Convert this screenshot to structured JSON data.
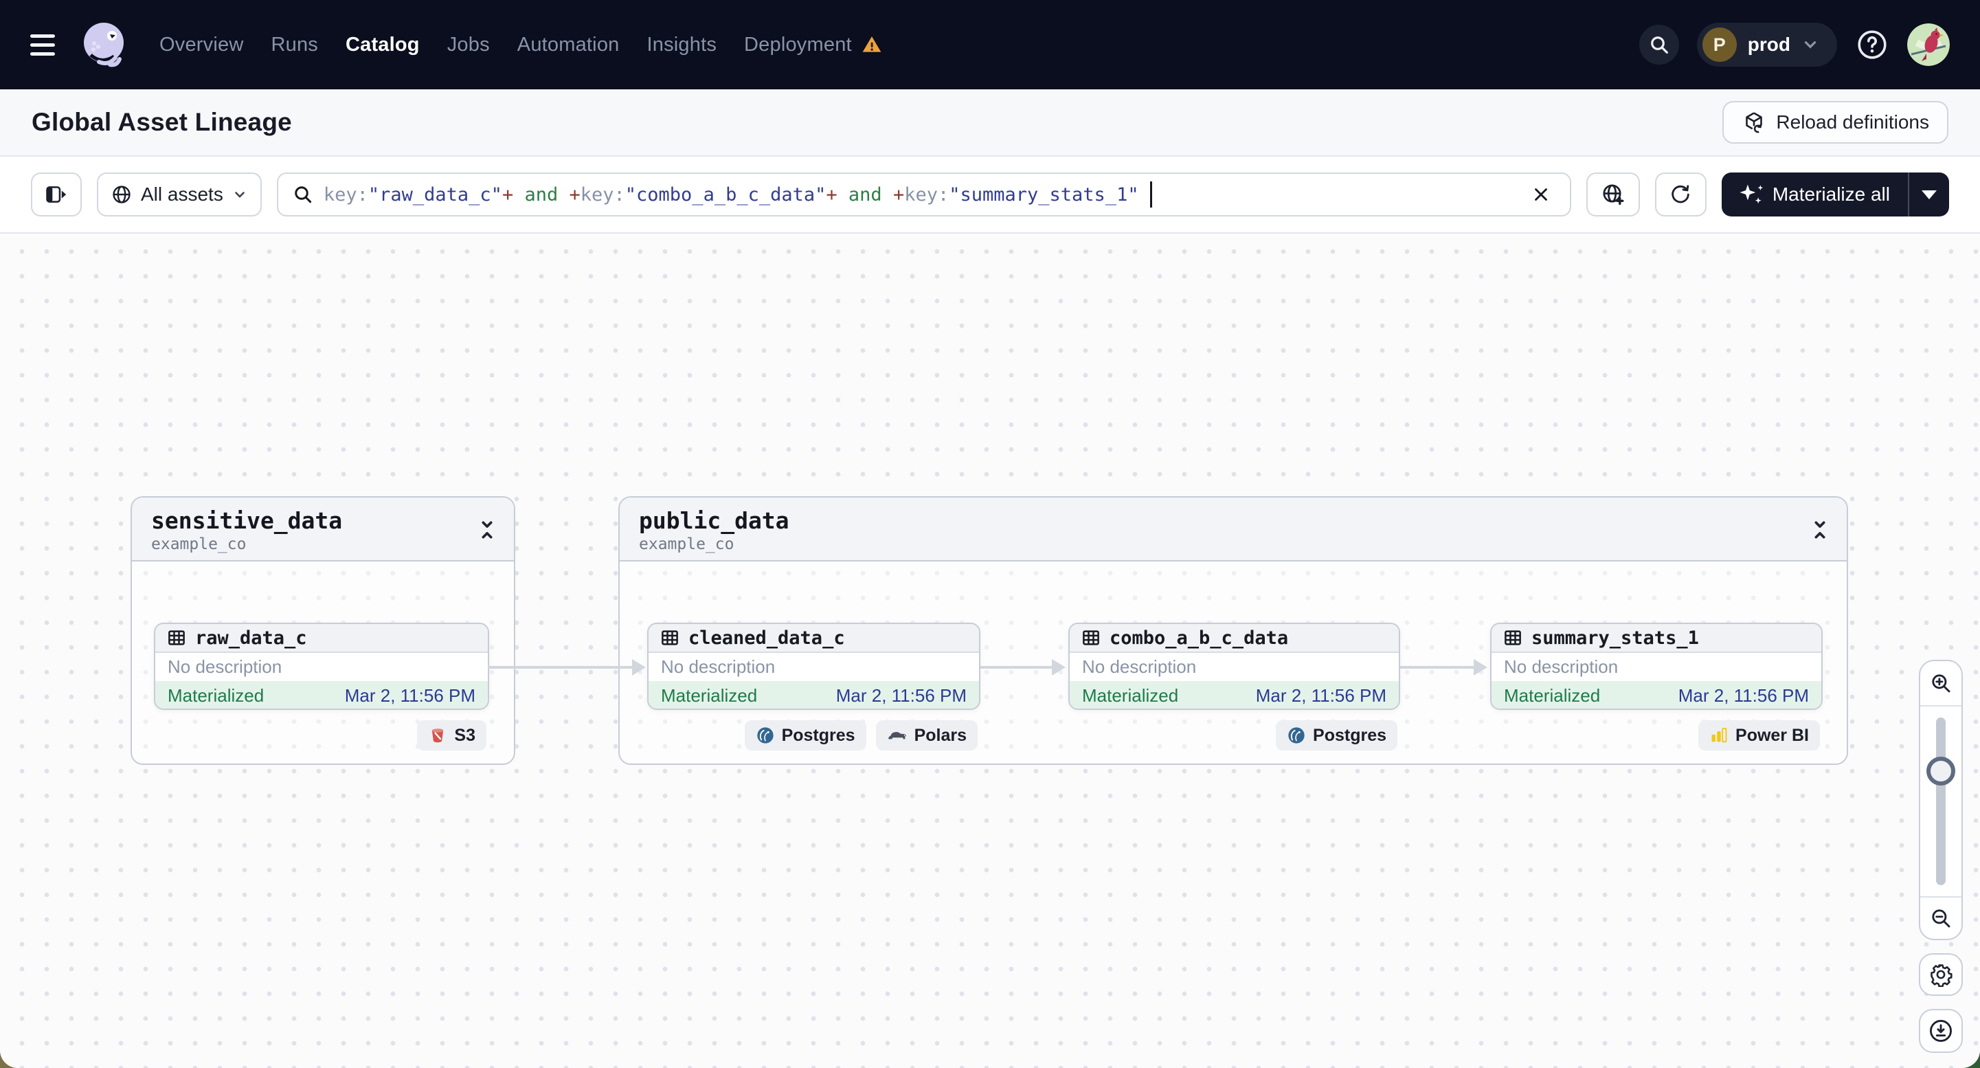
{
  "nav": {
    "items": [
      {
        "label": "Overview",
        "active": false
      },
      {
        "label": "Runs",
        "active": false
      },
      {
        "label": "Catalog",
        "active": true
      },
      {
        "label": "Jobs",
        "active": false
      },
      {
        "label": "Automation",
        "active": false
      },
      {
        "label": "Insights",
        "active": false
      },
      {
        "label": "Deployment",
        "active": false,
        "warning": true
      }
    ],
    "environment": {
      "initial": "P",
      "label": "prod"
    }
  },
  "header": {
    "title": "Global Asset Lineage",
    "reload_button_label": "Reload definitions"
  },
  "toolbar": {
    "asset_filter_label": "All assets",
    "materialize_button_label": "Materialize all",
    "query_segments": [
      {
        "text": "key:",
        "color": "gray"
      },
      {
        "text": "\"raw_data_c\"",
        "color": "navy"
      },
      {
        "text": "+",
        "color": "red"
      },
      {
        "text": " and ",
        "color": "green"
      },
      {
        "text": "+",
        "color": "red"
      },
      {
        "text": "key:",
        "color": "gray"
      },
      {
        "text": "\"combo_a_b_c_data\"",
        "color": "navy"
      },
      {
        "text": "+",
        "color": "red"
      },
      {
        "text": " and ",
        "color": "green"
      },
      {
        "text": "+",
        "color": "red"
      },
      {
        "text": "key:",
        "color": "gray"
      },
      {
        "text": "\"summary_stats_1\"",
        "color": "navy"
      }
    ]
  },
  "graph": {
    "groups": [
      {
        "name": "sensitive_data",
        "location": "example_co",
        "assets": [
          {
            "name": "raw_data_c",
            "description": "No description",
            "status": "Materialized",
            "timestamp": "Mar 2, 11:56 PM",
            "tags": [
              {
                "label": "S3",
                "icon": "s3-icon"
              }
            ]
          }
        ]
      },
      {
        "name": "public_data",
        "location": "example_co",
        "assets": [
          {
            "name": "cleaned_data_c",
            "description": "No description",
            "status": "Materialized",
            "timestamp": "Mar 2, 11:56 PM",
            "tags": [
              {
                "label": "Postgres",
                "icon": "postgres-icon"
              },
              {
                "label": "Polars",
                "icon": "polars-icon"
              }
            ]
          },
          {
            "name": "combo_a_b_c_data",
            "description": "No description",
            "status": "Materialized",
            "timestamp": "Mar 2, 11:56 PM",
            "tags": [
              {
                "label": "Postgres",
                "icon": "postgres-icon"
              }
            ]
          },
          {
            "name": "summary_stats_1",
            "description": "No description",
            "status": "Materialized",
            "timestamp": "Mar 2, 11:56 PM",
            "tags": [
              {
                "label": "Power BI",
                "icon": "powerbi-icon"
              }
            ]
          }
        ]
      }
    ]
  },
  "controls": {
    "zoom_slider_fraction": 0.28
  },
  "colors": {
    "nav_bg": "#0a0e1e",
    "status_green_text": "#1e7b49",
    "status_green_bg": "#e4f3ea",
    "timestamp_blue": "#2b3a94",
    "warning_orange": "#eda23b",
    "materialize_bg": "#141829",
    "query_string_navy": "#323c8f",
    "query_op_red": "#8f3a2e",
    "query_and_green": "#2e7d46"
  }
}
